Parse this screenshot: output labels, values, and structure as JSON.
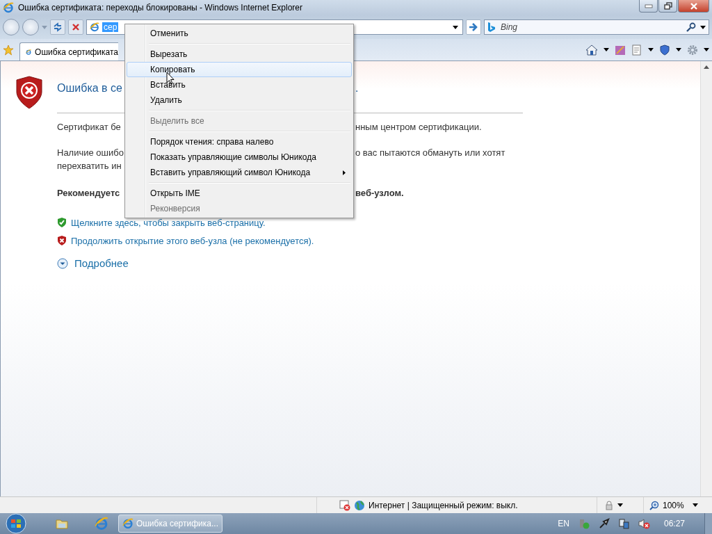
{
  "window": {
    "title": "Ошибка сертификата: переходы блокированы - Windows Internet Explorer"
  },
  "address_bar": {
    "value": "сер",
    "text_selected": true
  },
  "search": {
    "placeholder": "Bing"
  },
  "tabs": [
    {
      "label": "Ошибка сертификата",
      "selected": true
    }
  ],
  "page": {
    "heading": {
      "left": "Ошибка в се",
      "right": "."
    },
    "paragraphs": [
      {
        "kind": "text",
        "lines": [
          {
            "left": "Сертификат бе",
            "right": "нным центром сертификации."
          }
        ]
      },
      {
        "kind": "text",
        "lines": [
          {
            "left": "Наличие ошибо",
            "right": "о вас пытаются обмануть или хотят"
          },
          {
            "left": "перехватить ин"
          }
        ]
      },
      {
        "kind": "bold",
        "lines": [
          {
            "left": "Рекомендуетс",
            "right": "веб-узлом."
          }
        ]
      }
    ],
    "links": [
      {
        "kind": "safe",
        "text": "Щелкните здесь, чтобы закрыть веб-страницу."
      },
      {
        "kind": "unsafe",
        "text": "Продолжить открытие этого веб-узла (не рекомендуется)."
      }
    ],
    "more": "Подробнее"
  },
  "context_menu": {
    "items": [
      {
        "kind": "item",
        "label": "Отменить",
        "disabled": false,
        "selected": false
      },
      {
        "kind": "separator"
      },
      {
        "kind": "item",
        "label": "Вырезать",
        "disabled": false,
        "selected": false
      },
      {
        "kind": "item",
        "label": "Копировать",
        "disabled": false,
        "selected": true
      },
      {
        "kind": "item",
        "label": "Вставить",
        "disabled": false,
        "selected": false
      },
      {
        "kind": "item",
        "label": "Удалить",
        "disabled": false,
        "selected": false
      },
      {
        "kind": "separator"
      },
      {
        "kind": "item",
        "label": "Выделить все",
        "disabled": true,
        "selected": false
      },
      {
        "kind": "separator"
      },
      {
        "kind": "item",
        "label": "Порядок чтения: справа налево",
        "disabled": false,
        "selected": false
      },
      {
        "kind": "item",
        "label": "Показать управляющие символы Юникода",
        "disabled": false,
        "selected": false
      },
      {
        "kind": "submenu",
        "label": "Вставить управляющий символ Юникода",
        "disabled": false,
        "selected": false
      },
      {
        "kind": "separator"
      },
      {
        "kind": "item",
        "label": "Открыть IME",
        "disabled": false,
        "selected": false
      },
      {
        "kind": "item",
        "label": "Реконверсия",
        "disabled": true,
        "selected": false
      }
    ]
  },
  "status_bar": {
    "zone": "Интернет | Защищенный режим: выкл.",
    "zoom": "100%"
  },
  "taskbar": {
    "task": "Ошибка сертифика...",
    "language": "EN",
    "time": "06:27"
  }
}
